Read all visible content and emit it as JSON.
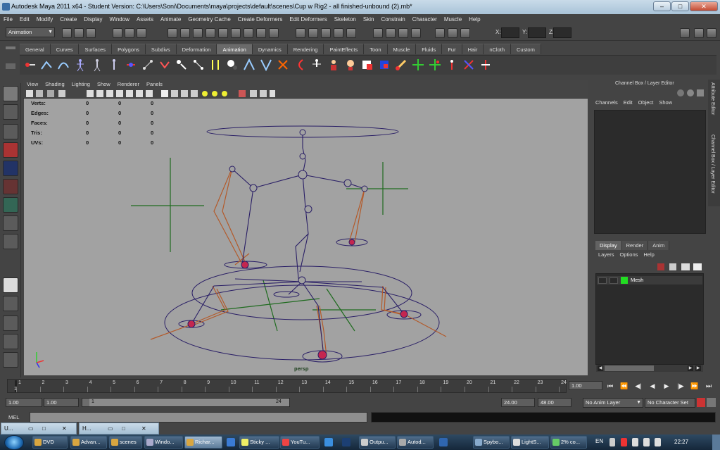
{
  "window": {
    "title": "Autodesk Maya 2011 x64 - Student Version: C:\\Users\\Soni\\Documents\\maya\\projects\\default\\scenes\\Cup w Rig2 - all finished-unbound (2).mb*",
    "controls": [
      "–",
      "□",
      "✕"
    ]
  },
  "menu": [
    "File",
    "Edit",
    "Modify",
    "Create",
    "Display",
    "Window",
    "Assets",
    "Animate",
    "Geometry Cache",
    "Create Deformers",
    "Edit Deformers",
    "Skeleton",
    "Skin",
    "Constrain",
    "Character",
    "Muscle",
    "Help"
  ],
  "statusline": {
    "mode": "Animation",
    "x_label": "X:",
    "y_label": "Y:",
    "z_label": "Z:"
  },
  "shelf": {
    "tabs": [
      "General",
      "Curves",
      "Surfaces",
      "Polygons",
      "Subdivs",
      "Deformation",
      "Animation",
      "Dynamics",
      "Rendering",
      "PaintEffects",
      "Toon",
      "Muscle",
      "Fluids",
      "Fur",
      "Hair",
      "nCloth",
      "Custom"
    ],
    "active_tab": "Animation"
  },
  "viewport": {
    "menu": [
      "View",
      "Shading",
      "Lighting",
      "Show",
      "Renderer",
      "Panels"
    ],
    "hud": {
      "rows": [
        {
          "label": "Verts:",
          "values": [
            "0",
            "0",
            "0"
          ]
        },
        {
          "label": "Edges:",
          "values": [
            "0",
            "0",
            "0"
          ]
        },
        {
          "label": "Faces:",
          "values": [
            "0",
            "0",
            "0"
          ]
        },
        {
          "label": "Tris:",
          "values": [
            "0",
            "0",
            "0"
          ]
        },
        {
          "label": "UVs:",
          "values": [
            "0",
            "0",
            "0"
          ]
        }
      ]
    },
    "camera_label": "persp"
  },
  "channel_box": {
    "header": "Channel Box / Layer Editor",
    "menu": [
      "Channels",
      "Edit",
      "Object",
      "Show"
    ],
    "side_tabs": [
      "Attribute Editor",
      "Channel Box / Layer Editor"
    ]
  },
  "layer_editor": {
    "tabs": [
      "Display",
      "Render",
      "Anim"
    ],
    "active_tab": "Display",
    "menu": [
      "Layers",
      "Options",
      "Help"
    ],
    "layers": [
      {
        "name": "Mesh",
        "color": "#22dd22"
      }
    ]
  },
  "time_slider": {
    "ticks": [
      "1",
      "2",
      "3",
      "4",
      "5",
      "6",
      "7",
      "8",
      "9",
      "10",
      "11",
      "12",
      "13",
      "14",
      "15",
      "16",
      "17",
      "18",
      "19",
      "20",
      "21",
      "22",
      "23",
      "24"
    ],
    "current_frame": "1",
    "current_time_field": "1.00"
  },
  "range_slider": {
    "start_field": "1.00",
    "playback_start": "1.00",
    "range_start_label": "1",
    "range_end_label": "24",
    "playback_end": "24.00",
    "end_field": "48.00",
    "anim_layer": "No Anim Layer",
    "character_set": "No Character Set"
  },
  "command_line": {
    "label": "MEL"
  },
  "minimized_windows": [
    {
      "label": "U..."
    },
    {
      "label": "H..."
    }
  ],
  "taskbar": {
    "items": [
      "DVD",
      "Advan...",
      "scenes",
      "Windo...",
      "Richar...",
      "Sticky ...",
      "YouTu...",
      "Outpu...",
      "Autod...",
      "Spybo...",
      "LightS...",
      "2% co..."
    ],
    "language": "EN",
    "time": "22:27"
  },
  "colors": {
    "viewport_bg": "#a2a2a2",
    "joint_color": "#2a1f66",
    "ik_color": "#b35a2a",
    "locator_color": "#1f6b1f",
    "joint_highlight": "#c4264f"
  }
}
